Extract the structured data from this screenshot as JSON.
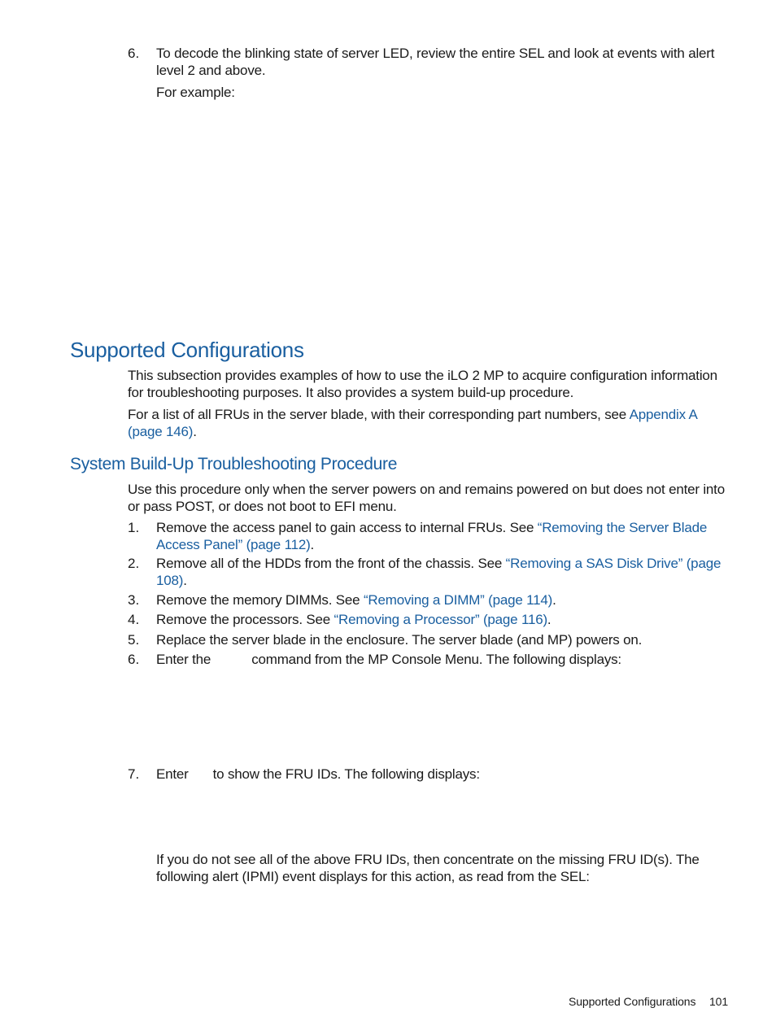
{
  "top_step": {
    "number": "6.",
    "text": "To decode the blinking state of server LED, review the entire SEL and look at events with alert level 2 and above.",
    "example_label": "For example:"
  },
  "section": {
    "heading": "Supported Configurations",
    "intro": "This subsection provides examples of how to use the iLO 2 MP to acquire configuration information for troubleshooting purposes. It also provides a system build-up procedure.",
    "fru_list_text": "For a list of all FRUs in the server blade, with their corresponding part numbers, see ",
    "fru_list_link": "Appendix A (page 146)",
    "fru_list_end": "."
  },
  "subsection": {
    "heading": "System Build-Up Troubleshooting Procedure",
    "intro": "Use this procedure only when the server powers on and remains powered on but does not enter into or pass POST, or does not boot to EFI menu.",
    "steps": [
      {
        "number": "1.",
        "text": "Remove the access panel to gain access to internal FRUs. See ",
        "link": "“Removing the Server Blade Access Panel” (page 112)",
        "end": "."
      },
      {
        "number": "2.",
        "text": "Remove all of the HDDs from the front of the chassis. See ",
        "link": "“Removing a SAS Disk Drive” (page 108)",
        "end": "."
      },
      {
        "number": "3.",
        "text": "Remove the memory DIMMs. See ",
        "link": "“Removing a DIMM” (page 114)",
        "end": "."
      },
      {
        "number": "4.",
        "text": "Remove the processors. See ",
        "link": "“Removing a Processor” (page 116)",
        "end": "."
      },
      {
        "number": "5.",
        "text": "Replace the server blade in the enclosure. The server blade (and MP) powers on.",
        "link": "",
        "end": ""
      },
      {
        "number": "6.",
        "text_before": "Enter the",
        "text_after": "command from the MP Console Menu. The following displays:"
      },
      {
        "number": "7.",
        "text_before": "Enter",
        "text_after": "to show the FRU IDs. The following displays:"
      }
    ],
    "missing_fru_note": "If you do not see all of the above FRU IDs, then concentrate on the missing FRU ID(s). The following alert (IPMI) event displays for this action, as read from the SEL:"
  },
  "footer": {
    "section_name": "Supported Configurations",
    "page_number": "101"
  }
}
